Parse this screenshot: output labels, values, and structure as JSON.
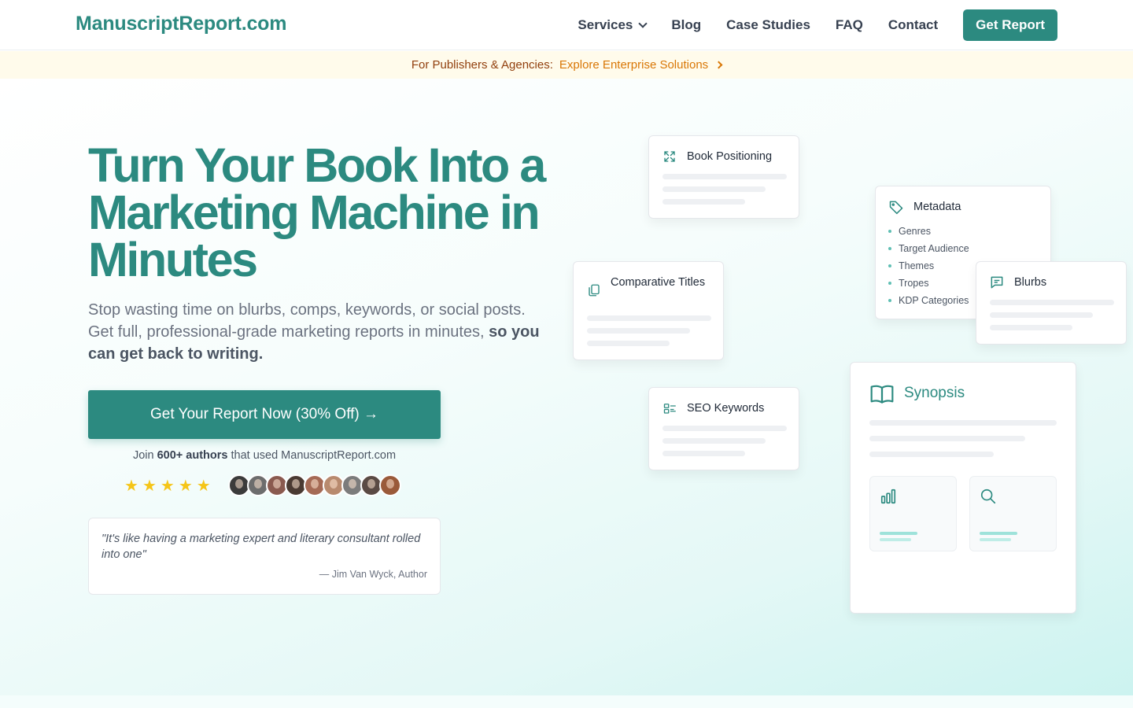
{
  "header": {
    "logo": "ManuscriptReport.com",
    "nav": [
      {
        "label": "Services"
      },
      {
        "label": "Blog"
      },
      {
        "label": "Case Studies"
      },
      {
        "label": "FAQ"
      },
      {
        "label": "Contact"
      }
    ],
    "cta_label": "Get Report"
  },
  "banner": {
    "lead": "For Publishers & Agencies:",
    "link": "Explore Enterprise Solutions"
  },
  "hero": {
    "headline": "Turn Your Book Into a Marketing Machine in Minutes",
    "sub_regular": "Stop wasting time on blurbs, comps, keywords, or social posts. Get full, professional-grade marketing reports in minutes,",
    "sub_bold": "so you can get back to writing.",
    "cta_label": "Get Your Report Now (30% Off) →",
    "social_prefix": "Join",
    "social_bold": "600+ authors",
    "social_suffix": "that used ManuscriptReport.com",
    "rating_stars": 5,
    "avatar_colors": [
      "#3b3b3b",
      "#6d6d6d",
      "#8a5a4f",
      "#4a3a32",
      "#a56a55",
      "#b88a6e",
      "#7c7c7c",
      "#5a4a44",
      "#9a5a3a"
    ]
  },
  "testimonial": {
    "quote": "\"It's like having a marketing expert and literary consultant rolled into one\"",
    "author": "— Jim Van Wyck, Author"
  },
  "cards": {
    "positioning": "Book Positioning",
    "metadata": "Metadata",
    "metadata_items": [
      "Genres",
      "Target Audience",
      "Themes",
      "Tropes",
      "KDP Categories"
    ],
    "comparative": "Comparative Titles",
    "blurbs": "Blurbs",
    "seo": "SEO Keywords",
    "synopsis": "Synopsis"
  },
  "colors": {
    "brand": "#2c8a80",
    "banner_bg": "#fffbeb",
    "banner_link": "#d97706",
    "star": "#f5c518"
  },
  "icons": [
    "chevron-down-icon",
    "chevron-right-icon",
    "star-icon",
    "expand-icon",
    "tag-icon",
    "copy-icon",
    "message-icon",
    "seo-icon",
    "book-open-icon",
    "bar-chart-icon",
    "search-icon"
  ]
}
